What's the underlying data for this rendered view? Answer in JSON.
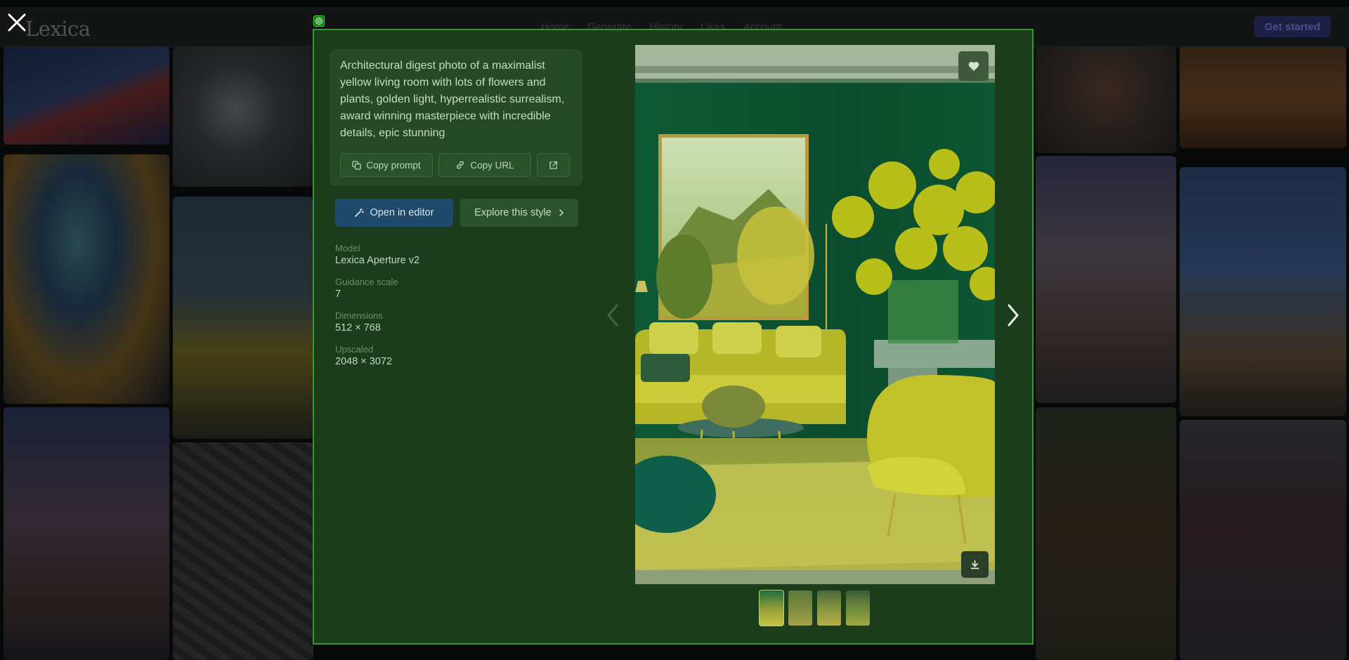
{
  "app": {
    "logo": "Lexica",
    "nav": [
      "Home",
      "Generate",
      "History",
      "Likes",
      "Account"
    ],
    "get_started_label": "Get started"
  },
  "modal": {
    "prompt": "Architectural digest photo of a maximalist yellow living room with lots of flowers and plants, golden light, hyperrealistic surrealism, award winning masterpiece with incredible details, epic stunning",
    "copy_prompt_label": "Copy prompt",
    "copy_url_label": "Copy URL",
    "open_editor_label": "Open in editor",
    "explore_style_label": "Explore this style",
    "meta": [
      {
        "key": "Model",
        "value": "Lexica Aperture v2"
      },
      {
        "key": "Guidance scale",
        "value": "7"
      },
      {
        "key": "Dimensions",
        "value": "512 × 768"
      },
      {
        "key": "Upscaled",
        "value": "2048 × 3072"
      }
    ],
    "thumbnail_count": 4,
    "active_thumbnail": 1
  },
  "colors": {
    "overlay_green": "#1b3d1b",
    "modal_border": "#2d9b2d",
    "editor_button": "#1f4a6a"
  },
  "icons": [
    "close-icon",
    "copy-icon",
    "link-icon",
    "external-link-icon",
    "wand-icon",
    "chevron-right-icon",
    "heart-icon",
    "download-icon",
    "chevron-left-icon",
    "target-icon"
  ]
}
